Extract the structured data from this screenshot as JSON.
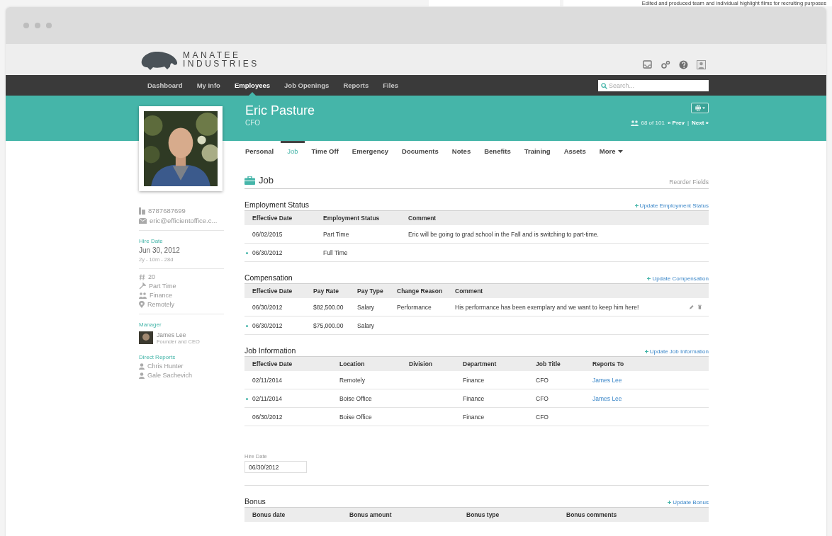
{
  "backdrop": {
    "caption": "Edited and produced team and individual highlight films for recruiting purposes"
  },
  "brand": {
    "line1": "MANATEE",
    "line2": "INDUSTRIES"
  },
  "nav": [
    {
      "label": "Dashboard",
      "selected": false
    },
    {
      "label": "My Info",
      "selected": false
    },
    {
      "label": "Employees",
      "selected": true
    },
    {
      "label": "Job Openings",
      "selected": false
    },
    {
      "label": "Reports",
      "selected": false
    },
    {
      "label": "Files",
      "selected": false
    }
  ],
  "search": {
    "placeholder": "Search..."
  },
  "employee": {
    "name": "Eric Pasture",
    "title": "CFO",
    "position": "68 of 101",
    "prev": "« Prev",
    "separator": "|",
    "next": "Next »"
  },
  "sidebar": {
    "contacts": [
      {
        "kind": "phone",
        "text": "8787687699"
      },
      {
        "kind": "email",
        "text": "eric@efficientoffice.c..."
      }
    ],
    "hire": {
      "label": "Hire Date",
      "date": "Jun 30, 2012",
      "tenure": "2y - 10m - 28d"
    },
    "facts": [
      {
        "kind": "id",
        "text": "20"
      },
      {
        "kind": "type",
        "text": "Part Time"
      },
      {
        "kind": "dept",
        "text": "Finance"
      },
      {
        "kind": "location",
        "text": "Remotely"
      }
    ],
    "manager": {
      "label": "Manager",
      "name": "James Lee",
      "role": "Founder and CEO"
    },
    "reports": {
      "label": "Direct Reports",
      "people": [
        "Chris Hunter",
        "Gale Sachevich"
      ]
    }
  },
  "tabs": [
    {
      "label": "Personal",
      "selected": false
    },
    {
      "label": "Job",
      "selected": true
    },
    {
      "label": "Time Off",
      "selected": false
    },
    {
      "label": "Emergency",
      "selected": false
    },
    {
      "label": "Documents",
      "selected": false
    },
    {
      "label": "Notes",
      "selected": false
    },
    {
      "label": "Benefits",
      "selected": false
    },
    {
      "label": "Training",
      "selected": false
    },
    {
      "label": "Assets",
      "selected": false
    },
    {
      "label": "More",
      "selected": false
    }
  ],
  "page": {
    "title": "Job",
    "reorder": "Reorder Fields"
  },
  "sections": [
    {
      "kind": "table",
      "title": "Employment Status",
      "action": "Update Employment Status",
      "columns": [
        {
          "label": "Effective Date",
          "kind": "text"
        },
        {
          "label": "Employment Status",
          "kind": "text"
        },
        {
          "label": "Comment",
          "kind": "text"
        }
      ],
      "rows": [
        {
          "current": false,
          "cells": [
            "06/02/2015",
            "Part Time",
            "Eric will be going to grad school in the Fall and is switching to part-time."
          ]
        },
        {
          "current": true,
          "cells": [
            "06/30/2012",
            "Full Time",
            ""
          ]
        }
      ]
    },
    {
      "kind": "table",
      "title": "Compensation",
      "action": "Update Compensation",
      "columns": [
        {
          "label": "Effective Date",
          "kind": "text"
        },
        {
          "label": "Pay Rate",
          "kind": "text"
        },
        {
          "label": "Pay Type",
          "kind": "text"
        },
        {
          "label": "Change Reason",
          "kind": "text"
        },
        {
          "label": "Comment",
          "kind": "text"
        }
      ],
      "rows": [
        {
          "current": false,
          "actions": true,
          "cells": [
            "06/30/2012",
            "$82,500.00",
            "Salary",
            "Performance",
            "His performance has been exemplary and we want to keep him here!"
          ]
        },
        {
          "current": true,
          "actions": false,
          "cells": [
            "06/30/2012",
            "$75,000.00",
            "Salary",
            "",
            ""
          ]
        }
      ]
    },
    {
      "kind": "table",
      "title": "Job Information",
      "action": "Update Job Information",
      "columns": [
        {
          "label": "Effective Date",
          "kind": "text"
        },
        {
          "label": "Location",
          "kind": "text"
        },
        {
          "label": "Division",
          "kind": "text"
        },
        {
          "label": "Department",
          "kind": "text"
        },
        {
          "label": "Job Title",
          "kind": "text"
        },
        {
          "label": "Reports To",
          "kind": "link"
        }
      ],
      "rows": [
        {
          "current": false,
          "cells": [
            "02/11/2014",
            "Remotely",
            "",
            "Finance",
            "CFO",
            "James Lee"
          ]
        },
        {
          "current": true,
          "cells": [
            "02/11/2014",
            "Boise Office",
            "",
            "Finance",
            "CFO",
            "James Lee"
          ]
        },
        {
          "current": false,
          "cells": [
            "06/30/2012",
            "Boise Office",
            "",
            "Finance",
            "CFO",
            ""
          ]
        }
      ]
    },
    {
      "kind": "field",
      "label": "Hire Date",
      "value": "06/30/2012"
    },
    {
      "kind": "table",
      "title": "Bonus",
      "action": "Update Bonus",
      "columns": [
        {
          "label": "Bonus date"
        },
        {
          "label": "Bonus amount"
        },
        {
          "label": "Bonus type"
        },
        {
          "label": "Bonus comments"
        }
      ]
    }
  ]
}
